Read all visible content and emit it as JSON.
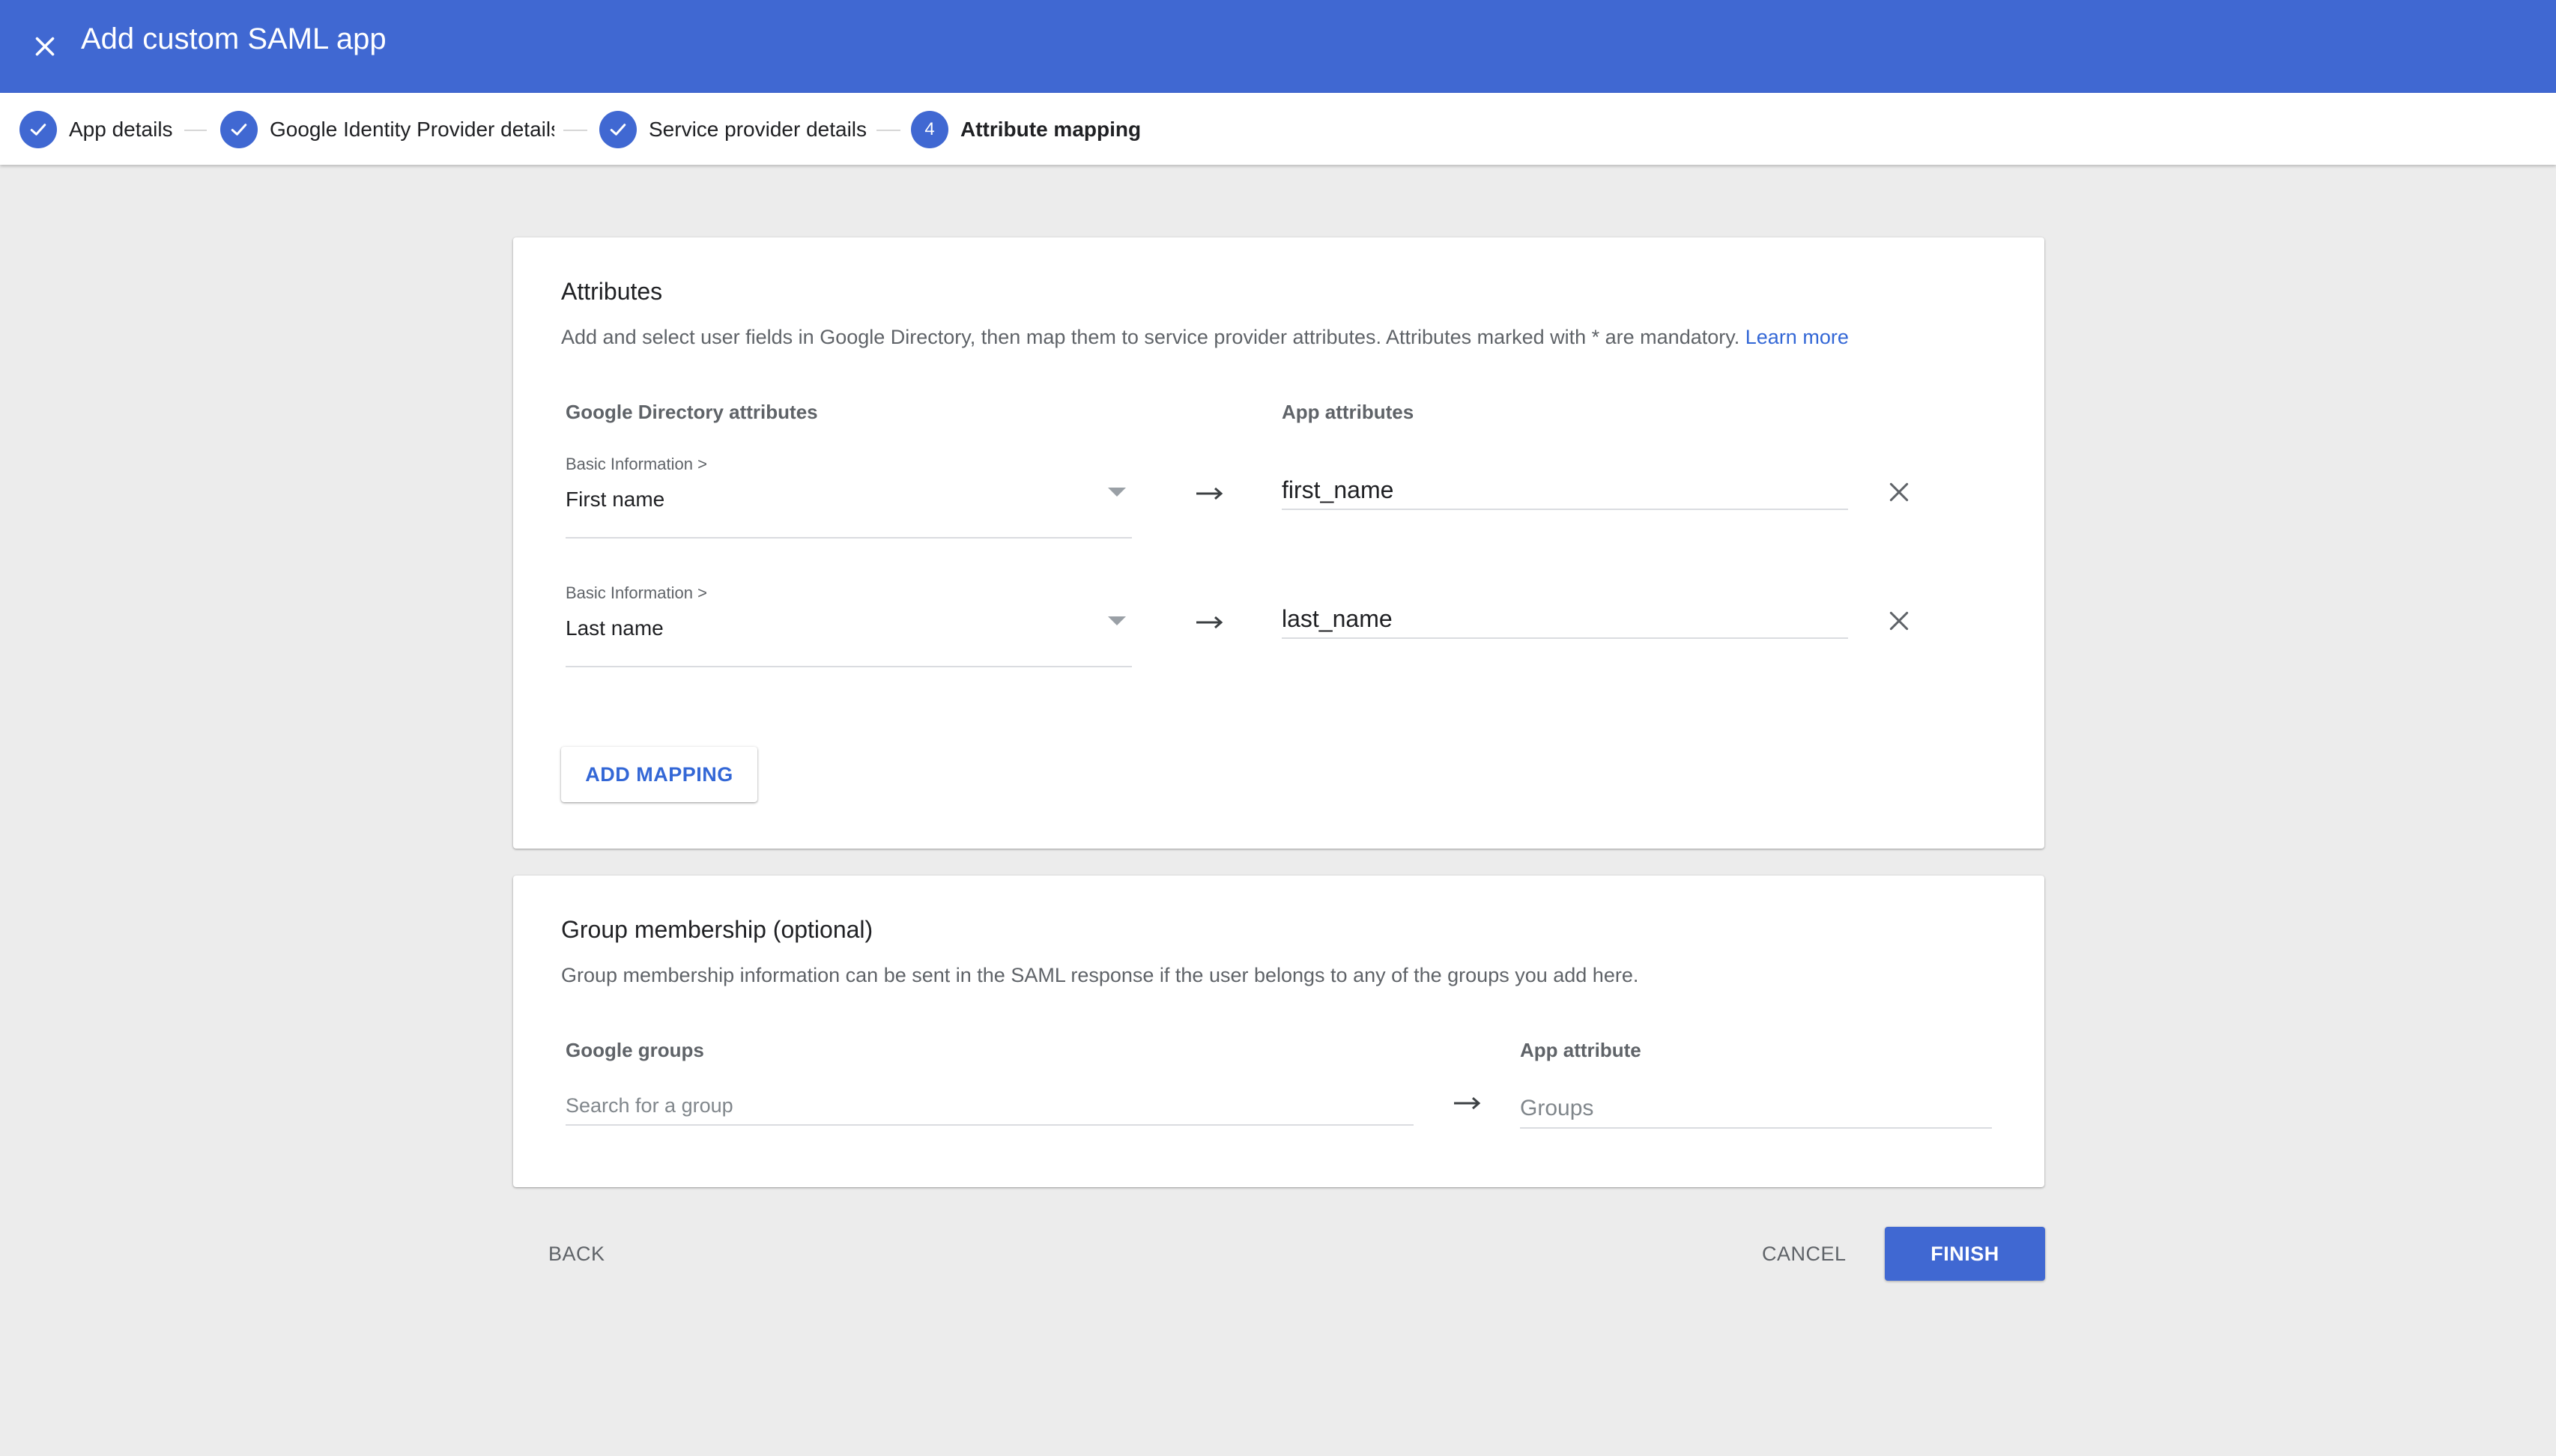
{
  "header": {
    "title": "Add custom SAML app",
    "close_icon": "close-icon",
    "bg_color": "#4068d2"
  },
  "stepper": {
    "steps": [
      {
        "label": "App details",
        "state": "done",
        "icon": "check-icon"
      },
      {
        "label": "Google Identity Provider details",
        "state": "done",
        "icon": "check-icon"
      },
      {
        "label": "Service provider details",
        "state": "done",
        "icon": "check-icon"
      },
      {
        "label": "Attribute mapping",
        "state": "active",
        "number": "4"
      }
    ]
  },
  "attributes": {
    "title": "Attributes",
    "description": "Add and select user fields in Google Directory, then map them to service provider attributes. Attributes marked with * are mandatory.",
    "learn_more": "Learn more",
    "col_directory": "Google Directory attributes",
    "col_app": "App attributes",
    "mappings": [
      {
        "category": "Basic Information >",
        "field": "First name",
        "app_attribute": "first_name"
      },
      {
        "category": "Basic Information >",
        "field": "Last name",
        "app_attribute": "last_name"
      }
    ],
    "add_mapping_label": "ADD MAPPING"
  },
  "groups": {
    "title": "Group membership (optional)",
    "description": "Group membership information can be sent in the SAML response if the user belongs to any of the groups you add here.",
    "col_groups": "Google groups",
    "col_app": "App attribute",
    "search_placeholder": "Search for a group",
    "app_attribute_placeholder": "Groups"
  },
  "actions": {
    "back": "BACK",
    "cancel": "CANCEL",
    "finish": "FINISH"
  },
  "colors": {
    "accent": "#4068d2",
    "link": "#3367d6",
    "background": "#ececec"
  }
}
